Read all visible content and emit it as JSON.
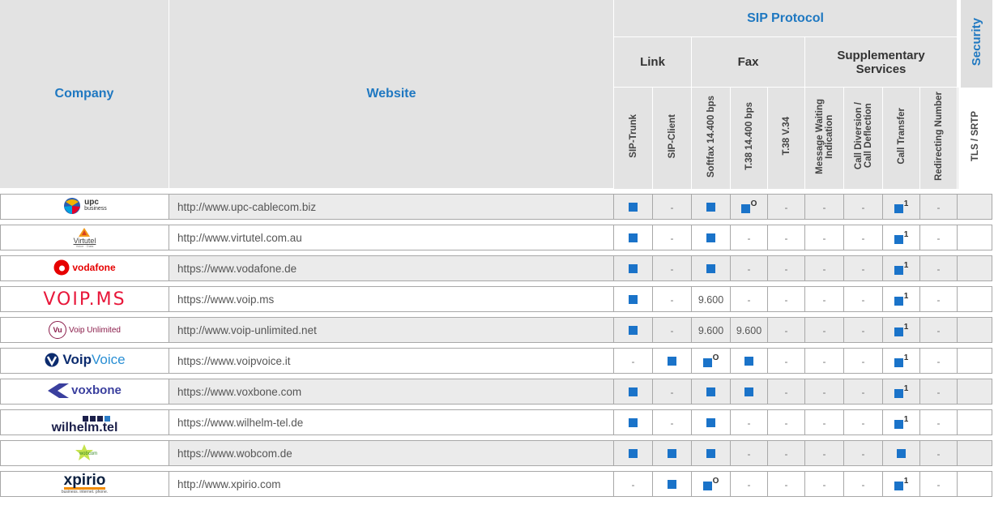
{
  "header": {
    "company": "Company",
    "website": "Website",
    "sip_protocol": "SIP Protocol",
    "security": "Security",
    "groups": {
      "link": "Link",
      "fax": "Fax",
      "supp_line1": "Supplementary",
      "supp_line2": "Services"
    },
    "columns": {
      "sip_trunk": "SIP-Trunk",
      "sip_client": "SIP-Client",
      "softfax": "Softfax 14.400 bps",
      "t38_14400": "T.38 14.400 bps",
      "t38_v34": "T.38 V.34",
      "mwi_line1": "Message Waiting",
      "mwi_line2": "Indication",
      "div_line1": "Call Diversion /",
      "div_line2": "Call Deflection",
      "transfer": "Call Transfer",
      "redirecting": "Redirecting Number",
      "tls": "TLS / SRTP"
    }
  },
  "logos": {
    "upc": {
      "line1": "upc",
      "line2": "business"
    },
    "virtutel": {
      "line1": "Virtutel",
      "line2": "Voice · Data"
    },
    "vodafone": "vodafone",
    "voipms": "VOIP.MS",
    "voipunlimited": {
      "badge": "Vu",
      "text": "Voip Unlimited"
    },
    "voipvoice": {
      "a": "Voip",
      "b": "Voice"
    },
    "voxbone": "voxbone",
    "wilhelm": "wilhelm.tel",
    "wobcom": "wobcom",
    "xpirio": {
      "line1": "xpirio",
      "line2": "business. internet. phone."
    }
  },
  "colors": {
    "accent": "#1f78c1",
    "square": "#1a73c9"
  },
  "rows": [
    {
      "site": "http://www.upc-cablecom.biz",
      "cells": [
        "sq",
        "-",
        "sq",
        "sq:O",
        "-",
        "-",
        "-",
        "sq:1",
        "-",
        ""
      ]
    },
    {
      "site": "http://www.virtutel.com.au",
      "cells": [
        "sq",
        "-",
        "sq",
        "-",
        "-",
        "-",
        "-",
        "sq:1",
        "-",
        ""
      ]
    },
    {
      "site": "https://www.vodafone.de",
      "cells": [
        "sq",
        "-",
        "sq",
        "-",
        "-",
        "-",
        "-",
        "sq:1",
        "-",
        ""
      ]
    },
    {
      "site": "https://www.voip.ms",
      "cells": [
        "sq",
        "-",
        "9.600",
        "-",
        "-",
        "-",
        "-",
        "sq:1",
        "-",
        ""
      ]
    },
    {
      "site": "http://www.voip-unlimited.net",
      "cells": [
        "sq",
        "-",
        "9.600",
        "9.600",
        "-",
        "-",
        "-",
        "sq:1",
        "-",
        ""
      ]
    },
    {
      "site": "https://www.voipvoice.it",
      "cells": [
        "-",
        "sq",
        "sq:O",
        "sq",
        "-",
        "-",
        "-",
        "sq:1",
        "-",
        ""
      ]
    },
    {
      "site": "https://www.voxbone.com",
      "cells": [
        "sq",
        "-",
        "sq",
        "sq",
        "-",
        "-",
        "-",
        "sq:1",
        "-",
        ""
      ]
    },
    {
      "site": "https://www.wilhelm-tel.de",
      "cells": [
        "sq",
        "-",
        "sq",
        "-",
        "-",
        "-",
        "-",
        "sq:1",
        "-",
        ""
      ]
    },
    {
      "site": "https://www.wobcom.de",
      "cells": [
        "sq",
        "sq",
        "sq",
        "-",
        "-",
        "-",
        "-",
        "sq",
        "-",
        ""
      ]
    },
    {
      "site": "http://www.xpirio.com",
      "cells": [
        "-",
        "sq",
        "sq:O",
        "-",
        "-",
        "-",
        "-",
        "sq:1",
        "-",
        ""
      ]
    }
  ]
}
